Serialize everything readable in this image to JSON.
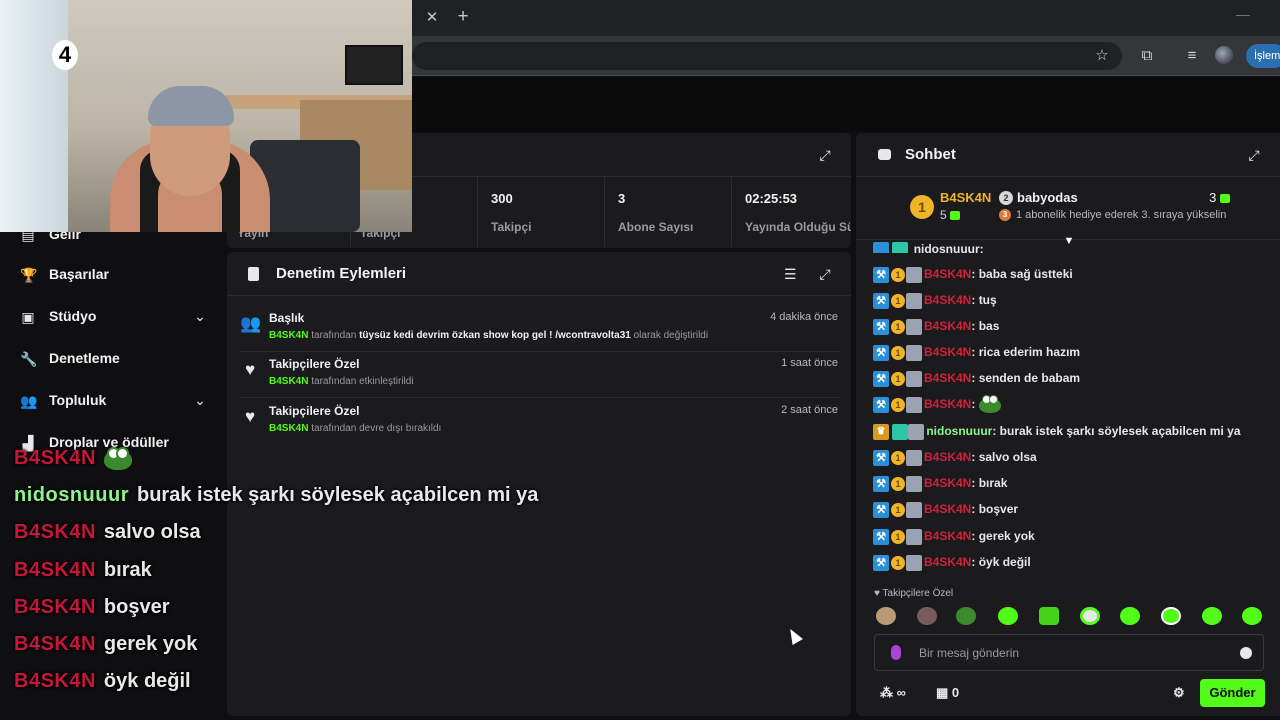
{
  "browser": {
    "tab_close": "✕",
    "tab_new": "+",
    "action_label": "İşlem"
  },
  "stats": {
    "partial_labels": [
      "Yayın",
      "Takipçi"
    ],
    "items": [
      {
        "value": "300",
        "label": "Takipçi"
      },
      {
        "value": "3",
        "label": "Abone Sayısı"
      },
      {
        "value": "02:25:53",
        "label": "Yayında Olduğu Süre"
      }
    ]
  },
  "sidebar": {
    "items": [
      {
        "label": "Gelir",
        "icon": "revenue-icon"
      },
      {
        "label": "Başarılar",
        "icon": "trophy-icon"
      },
      {
        "label": "Stüdyo",
        "icon": "studio-icon",
        "has_chevron": true
      },
      {
        "label": "Denetleme",
        "icon": "wrench-icon"
      },
      {
        "label": "Topluluk",
        "icon": "community-icon",
        "has_chevron": true
      },
      {
        "label": "Droplar ve ödüller",
        "icon": "drops-icon"
      }
    ]
  },
  "moderation": {
    "title": "Denetim Eylemleri",
    "events": [
      {
        "title": "Başlık",
        "time": "4 dakika önce",
        "user": "B4SK4N",
        "by": "tarafından",
        "quote": "tüysüz kedi devrim özkan show kop gel ! /wcontravolta31",
        "action": "olarak değiştirildi",
        "icon": "users-icon"
      },
      {
        "title": "Takipçilere Özel",
        "time": "1 saat önce",
        "user": "B4SK4N",
        "by": "tarafından",
        "quote": "",
        "action": "etkinleştirildi",
        "icon": "heart-icon"
      },
      {
        "title": "Takipçilere Özel",
        "time": "2 saat önce",
        "user": "B4SK4N",
        "by": "tarafından",
        "quote": "",
        "action": "devre dışı bırakıldı",
        "icon": "heart-icon"
      }
    ]
  },
  "overlay_chat": [
    {
      "user": "B4SK4N",
      "color": "red",
      "msg": "",
      "emote": true
    },
    {
      "user": "nidosnuuur",
      "color": "green",
      "msg": "burak istek şarkı söylesek açabilcen mi ya"
    },
    {
      "user": "B4SK4N",
      "color": "red",
      "msg": "salvo olsa"
    },
    {
      "user": "B4SK4N",
      "color": "red",
      "msg": "bırak"
    },
    {
      "user": "B4SK4N",
      "color": "red",
      "msg": "boşver"
    },
    {
      "user": "B4SK4N",
      "color": "red",
      "msg": "gerek yok"
    },
    {
      "user": "B4SK4N",
      "color": "red",
      "msg": "öyk değil"
    }
  ],
  "webcam": {
    "badge": "4"
  },
  "chat": {
    "title": "Sohbet",
    "pinned": {
      "rank": "1",
      "user": "B4SK4N",
      "user_count": "5",
      "user2_rank": "2",
      "user2": "babyodas",
      "count": "3",
      "desc_rank": "3",
      "desc": "1 abonelik hediye ederek 3. sıraya yükselin"
    },
    "partial_top": "nidosnuuur:",
    "messages": [
      {
        "user": "B4SK4N",
        "text": ": baba sağ üstteki"
      },
      {
        "user": "B4SK4N",
        "text": ": tuş"
      },
      {
        "user": "B4SK4N",
        "text": ": bas"
      },
      {
        "user": "B4SK4N",
        "text": ": rica ederim hazım"
      },
      {
        "user": "B4SK4N",
        "text": ": senden de babam"
      },
      {
        "user": "B4SK4N",
        "text": ":",
        "emote": true
      },
      {
        "user": "nidosnuuur",
        "text": ": burak istek şarkı söylesek açabilcen mi ya",
        "green": true
      },
      {
        "user": "B4SK4N",
        "text": ": salvo olsa"
      },
      {
        "user": "B4SK4N",
        "text": ": bırak"
      },
      {
        "user": "B4SK4N",
        "text": ": boşver"
      },
      {
        "user": "B4SK4N",
        "text": ": gerek yok"
      },
      {
        "user": "B4SK4N",
        "text": ": öyk değil"
      }
    ],
    "emote_mode": "Takipçilere Özel",
    "input_placeholder": "Bir mesaj gönderin",
    "points_value": "∞",
    "store_count": "0",
    "send_label": "Gönder",
    "accent": "#53fc18"
  }
}
